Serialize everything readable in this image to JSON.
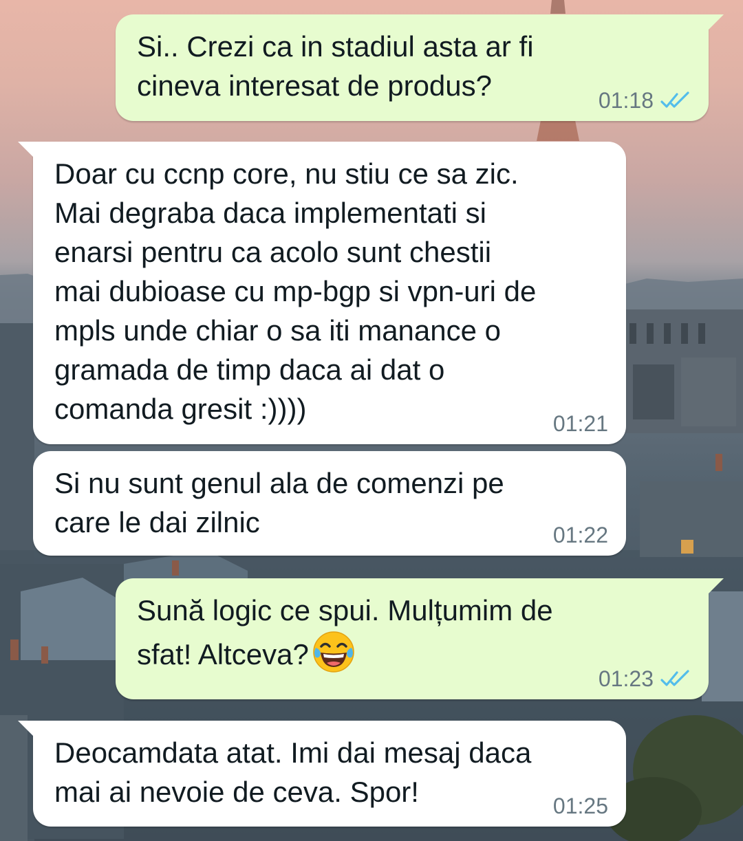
{
  "theme": {
    "outgoing_bubble": "#e7fccf",
    "incoming_bubble": "#ffffff",
    "read_tick_color": "#53bdeb",
    "time_color": "#667781"
  },
  "wallpaper": {
    "description_icon": "paris-rooftops-wallpaper"
  },
  "messages": [
    {
      "direction": "outgoing",
      "text": "Si.. Crezi ca in stadiul asta ar fi\ncineva interesat de produs?",
      "time": "01:18",
      "status_icon": "double-check-read-icon"
    },
    {
      "direction": "incoming",
      "text": "Doar cu ccnp core, nu stiu ce sa zic.\nMai degraba daca implementati si\nenarsi pentru ca acolo sunt chestii\nmai dubioase cu mp-bgp si vpn-uri de\nmpls unde chiar o sa iti manance o\ngramada de timp daca ai dat o\ncomanda gresit :))))",
      "time": "01:21"
    },
    {
      "direction": "incoming",
      "text": "Si nu sunt genul ala de comenzi pe\ncare le dai zilnic",
      "time": "01:22"
    },
    {
      "direction": "outgoing",
      "text": "Sună logic ce spui. Mulțumim de\nsfat! Altceva?",
      "emoji": "face-with-tears-of-joy-icon",
      "time": "01:23",
      "status_icon": "double-check-read-icon"
    },
    {
      "direction": "incoming",
      "text": "Deocamdata atat. Imi dai mesaj daca\nmai ai nevoie de ceva. Spor!",
      "time": "01:25"
    }
  ]
}
